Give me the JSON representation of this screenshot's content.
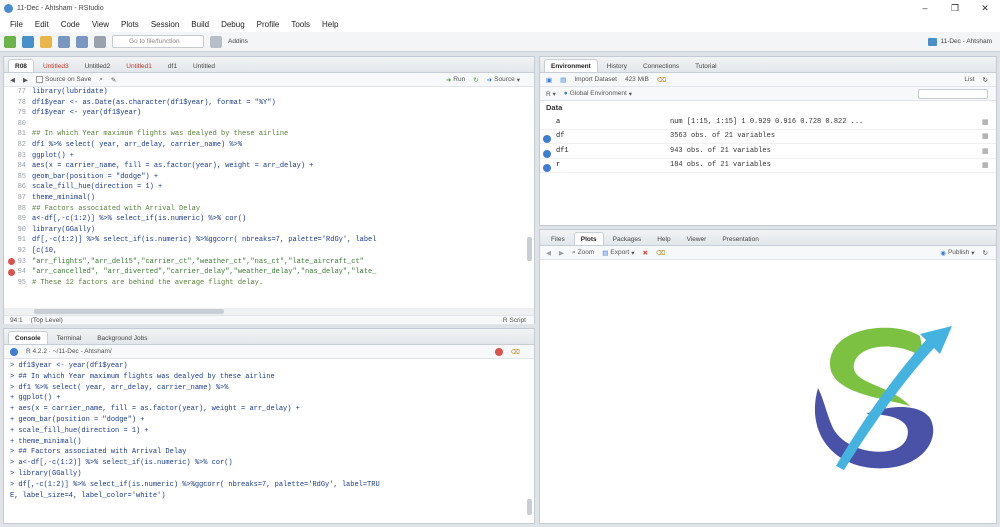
{
  "window": {
    "title": "11-Dec - Ahtsham - RStudio",
    "controls": [
      "–",
      "❐",
      "✕"
    ]
  },
  "menu": [
    "File",
    "Edit",
    "Code",
    "View",
    "Plots",
    "Session",
    "Build",
    "Debug",
    "Profile",
    "Tools",
    "Help"
  ],
  "toolbar": {
    "goto_placeholder": "Go to file/function",
    "addins": "Addins",
    "project": "11-Dec - Ahtsham"
  },
  "editor": {
    "tabs": [
      "R08",
      "Untitled3",
      "Untitled2",
      "Untitled1",
      "df1",
      "Untitled"
    ],
    "source_on_save": "Source on Save",
    "run_label": "Run",
    "source_label": "Source",
    "status_left": "(Top Level)",
    "status_right": "R Script",
    "lines": [
      {
        "n": "77",
        "code": "library(lubridate)"
      },
      {
        "n": "78",
        "code": "df1$year <- as.Date(as.character(df1$year), format = \"%Y\")"
      },
      {
        "n": "79",
        "code": "df1$year <- year(df1$year)"
      },
      {
        "n": "80",
        "code": ""
      },
      {
        "n": "81",
        "code": "## In which Year maximum flights was dealyed by these airline"
      },
      {
        "n": "82",
        "code": "df1 %>% select( year, arr_delay, carrier_name) %>%"
      },
      {
        "n": "83",
        "code": "    ggplot() +"
      },
      {
        "n": "84",
        "code": "    aes(x = carrier_name, fill = as.factor(year), weight = arr_delay) +"
      },
      {
        "n": "85",
        "code": "    geom_bar(position = \"dodge\") +"
      },
      {
        "n": "86",
        "code": "    scale_fill_hue(direction = 1) +"
      },
      {
        "n": "87",
        "code": "    theme_minimal()"
      },
      {
        "n": "88",
        "code": "## Factors associated with Arrival Delay"
      },
      {
        "n": "89",
        "code": "a<-df[,-c(1:2)] %>% select_if(is.numeric) %>% cor()"
      },
      {
        "n": "90",
        "code": "library(GGally)"
      },
      {
        "n": "91",
        "code": "df[,-c(1:2)] %>% select_if(is.numeric) %>%ggcorr( nbreaks=7, palette='RdGy', label"
      },
      {
        "n": "92",
        "code": "[c(10,"
      },
      {
        "n": "93",
        "code": "\"arr_flights\",\"arr_del15\",\"carrier_ct\",\"weather_ct\",\"nas_ct\",\"late_aircraft_ct\""
      },
      {
        "n": "94",
        "code": "\"arr_cancelled\", \"arr_diverted\",\"carrier_delay\",\"weather_delay\",\"nas_delay\",\"late_"
      },
      {
        "n": "95",
        "code": "# These 12 factors are behind the average flight delay."
      }
    ]
  },
  "console": {
    "tabs": [
      "Console",
      "Terminal",
      "Background Jobs"
    ],
    "path": "R 4.2.2 · ~/11-Dec - Ahtsham/",
    "lines": [
      "> df1$year <- year(df1$year)",
      "> ## In which Year maximum flights was dealyed by these airline",
      "> df1 %>% select( year, arr_delay, carrier_name) %>%",
      "+     ggplot() +",
      "+     aes(x = carrier_name, fill = as.factor(year), weight = arr_delay) +",
      "+     geom_bar(position = \"dodge\") +",
      "+     scale_fill_hue(direction = 1) +",
      "+     theme_minimal()",
      "> ## Factors associated with Arrival Delay",
      "> a<-df[,-c(1:2)] %>% select_if(is.numeric) %>% cor()",
      "> library(GGally)",
      "> df[,-c(1:2)] %>% select_if(is.numeric) %>%ggcorr( nbreaks=7, palette='RdGy', label=TRU",
      "E, label_size=4, label_color='white')"
    ]
  },
  "environment": {
    "tabs": [
      "Environment",
      "History",
      "Connections",
      "Tutorial"
    ],
    "import_dataset": "Import Dataset",
    "memory": "423 MiB",
    "list_label": "List",
    "scope": "Global Environment",
    "section": "Data",
    "rows": [
      {
        "name": "a",
        "value": "num [1:15, 1:15] 1 0.929 0.916 0.728 0.822 ...",
        "dot": false
      },
      {
        "name": "df",
        "value": "3563 obs. of 21 variables",
        "dot": true
      },
      {
        "name": "df1",
        "value": "943 obs. of 21 variables",
        "dot": true
      },
      {
        "name": "r",
        "value": "184 obs. of 21 variables",
        "dot": true
      }
    ]
  },
  "files": {
    "tabs": [
      "Files",
      "Plots",
      "Packages",
      "Help",
      "Viewer",
      "Presentation"
    ],
    "zoom": "Zoom",
    "export": "Export",
    "publish": "Publish"
  },
  "colors": {
    "logo_green": "#7cc142",
    "logo_blue": "#45b3e0",
    "logo_purple": "#4a52a8"
  }
}
